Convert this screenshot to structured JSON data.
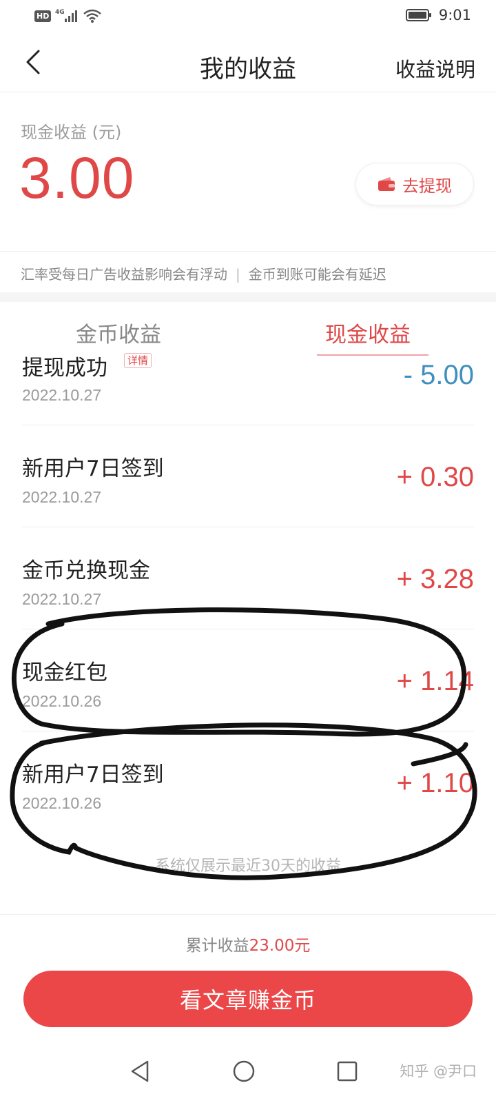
{
  "status_bar": {
    "hd": "HD",
    "network": "4G",
    "time": "9:01"
  },
  "header": {
    "title": "我的收益",
    "right_link": "收益说明",
    "back_icon": "chevron-left-icon"
  },
  "balance": {
    "label": "现金收益 (元)",
    "amount": "3.00",
    "withdraw_label": "去提现",
    "withdraw_icon": "wallet-icon"
  },
  "notice": {
    "left": "汇率受每日广告收益影响会有浮动",
    "separator": "|",
    "right": "金币到账可能会有延迟"
  },
  "tabs": [
    {
      "label": "金币收益",
      "active": false
    },
    {
      "label": "现金收益",
      "active": true
    }
  ],
  "records": [
    {
      "title": "提现成功",
      "badge": "详情",
      "date": "2022.10.27",
      "amount": "- 5.00",
      "type": "debit"
    },
    {
      "title": "新用户7日签到",
      "date": "2022.10.27",
      "amount": "+ 0.30",
      "type": "credit"
    },
    {
      "title": "金币兑换现金",
      "date": "2022.10.27",
      "amount": "+ 3.28",
      "type": "credit"
    },
    {
      "title": "现金红包",
      "date": "2022.10.26",
      "amount": "+ 1.14",
      "type": "credit"
    },
    {
      "title": "新用户7日签到",
      "date": "2022.10.26",
      "amount": "+ 1.10",
      "type": "credit"
    }
  ],
  "list_footer": "系统仅展示最近30天的收益",
  "total": {
    "label": "累计收益",
    "value": "23.00元"
  },
  "cta": {
    "label": "看文章赚金币"
  },
  "watermark": "知乎 @尹口",
  "colors": {
    "accent_red": "#e04848",
    "debit_blue": "#3f8fbf",
    "cta_red": "#ec4748"
  }
}
